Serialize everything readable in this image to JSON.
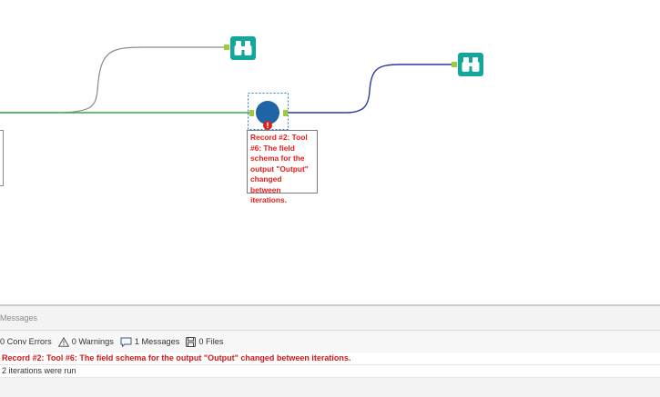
{
  "canvas": {
    "tools": [
      {
        "name": "browse-tool-top",
        "icon": "binoculars-icon"
      },
      {
        "name": "browse-tool-right",
        "icon": "binoculars-icon"
      },
      {
        "name": "selected-tool",
        "icon": "circle-tool-icon",
        "status": "error-badge-icon"
      }
    ],
    "error_annotation": "Record #2: Tool #6: The field schema for the output \"Output\" changed between iterations.",
    "colors": {
      "browse_teal": "#11a79a",
      "tool_blue": "#1f65a6",
      "connection_green": "#3aa64a",
      "connection_gray": "#8a8a8a",
      "connection_navy": "#2a3aa0",
      "error_red": "#e0201b"
    }
  },
  "results": {
    "panel_title": "Messages",
    "toolbar": {
      "conv_errors": "0 Conv Errors",
      "warnings": "0 Warnings",
      "messages": "1 Messages",
      "files": "0 Files"
    },
    "messages": [
      {
        "type": "error",
        "text": "Record #2: Tool #6: The field schema for the output \"Output\" changed between iterations."
      },
      {
        "type": "info",
        "text": "2 iterations were run"
      }
    ]
  }
}
